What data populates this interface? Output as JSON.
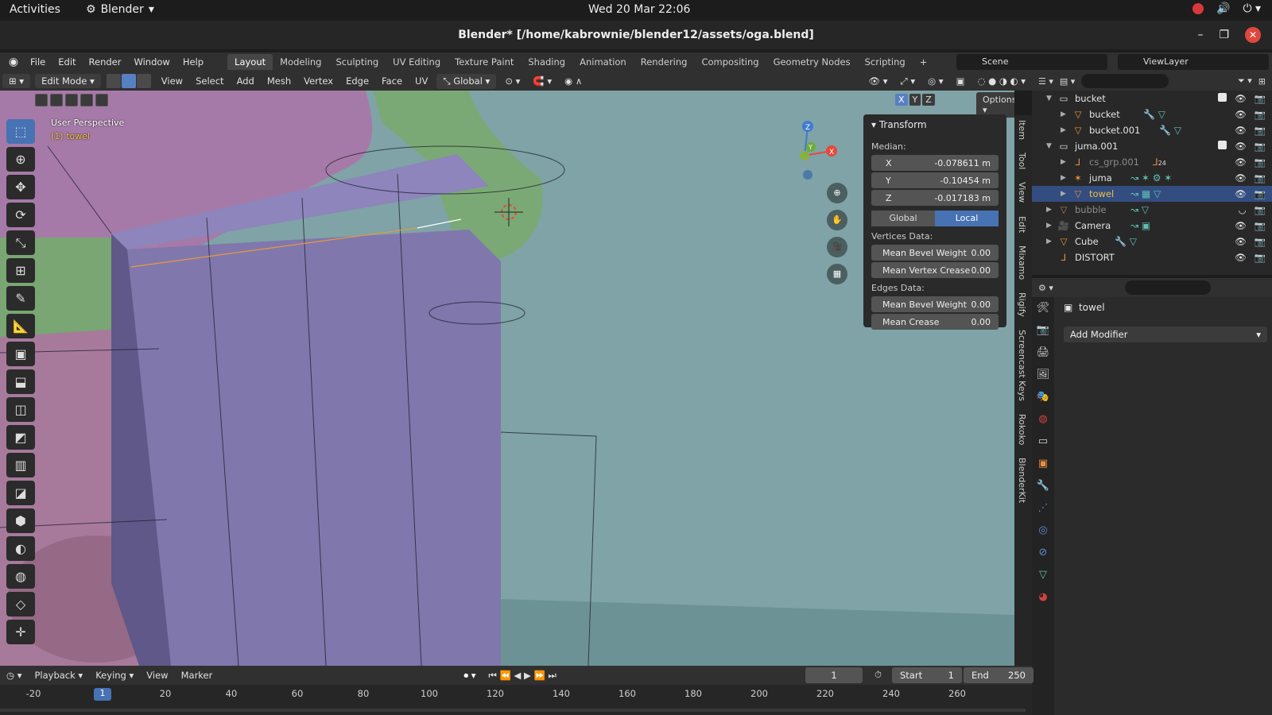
{
  "gnome": {
    "activities": "Activities",
    "app": "Blender",
    "clock": "Wed 20 Mar  22:06"
  },
  "window": {
    "title": "Blender* [/home/kabrownie/blender12/assets/oga.blend]"
  },
  "menu": {
    "items": [
      "File",
      "Edit",
      "Render",
      "Window",
      "Help"
    ]
  },
  "workspaces": {
    "tabs": [
      "Layout",
      "Modeling",
      "Sculpting",
      "UV Editing",
      "Texture Paint",
      "Shading",
      "Animation",
      "Rendering",
      "Compositing",
      "Geometry Nodes",
      "Scripting"
    ],
    "active": "Layout"
  },
  "scene": "Scene",
  "view_layer": "ViewLayer",
  "header": {
    "mode": "Edit Mode",
    "view": "View",
    "select": "Select",
    "add": "Add",
    "mesh": "Mesh",
    "vertex": "Vertex",
    "edge": "Edge",
    "face": "Face",
    "uv": "UV",
    "orientation": "Global"
  },
  "viewport": {
    "perspective": "User Perspective",
    "object": "(1) towel",
    "options": "Options",
    "axes": [
      "X",
      "Y",
      "Z"
    ]
  },
  "transform": {
    "title": "Transform",
    "median_label": "Median:",
    "x_label": "X",
    "x": "-0.078611 m",
    "y_label": "Y",
    "y": "-0.10454 m",
    "z_label": "Z",
    "z": "-0.017183 m",
    "global": "Global",
    "local": "Local",
    "vertices_label": "Vertices Data:",
    "mean_bevel_weight_label": "Mean Bevel Weight",
    "mean_bevel_weight": "0.00",
    "mean_vertex_crease_label": "Mean Vertex Crease",
    "mean_vertex_crease": "0.00",
    "edges_label": "Edges Data:",
    "edge_bevel_weight_label": "Mean Bevel Weight",
    "edge_bevel_weight": "0.00",
    "mean_crease_label": "Mean Crease",
    "mean_crease": "0.00"
  },
  "sidetabs": [
    "Item",
    "Tool",
    "View",
    "Edit",
    "Mixamo",
    "Rigify",
    "Screencast Keys",
    "Rokoko",
    "BlenderKit"
  ],
  "outliner": {
    "rows": [
      {
        "name": "bucket",
        "type": "collection"
      },
      {
        "name": "bucket",
        "type": "mesh"
      },
      {
        "name": "bucket.001",
        "type": "mesh"
      },
      {
        "name": "juma.001",
        "type": "collection"
      },
      {
        "name": "cs_grp.001",
        "type": "empty",
        "badge": "24"
      },
      {
        "name": "juma",
        "type": "armature"
      },
      {
        "name": "towel",
        "type": "mesh"
      },
      {
        "name": "bubble",
        "type": "mesh"
      },
      {
        "name": "Camera",
        "type": "camera"
      },
      {
        "name": "Cube",
        "type": "mesh"
      },
      {
        "name": "DISTORT",
        "type": "empty"
      }
    ]
  },
  "properties": {
    "object": "towel",
    "add_modifier": "Add Modifier"
  },
  "timeline": {
    "playback": "Playback",
    "keying": "Keying",
    "view": "View",
    "marker": "Marker",
    "current_frame": "1",
    "start_label": "Start",
    "start": "1",
    "end_label": "End",
    "end": "250",
    "ticks": [
      "-20",
      "1",
      "20",
      "40",
      "60",
      "80",
      "100",
      "120",
      "140",
      "160",
      "180",
      "200",
      "220",
      "240",
      "260"
    ]
  },
  "colors": {
    "accent": "#4772b3",
    "viewport_bg": "#7fa3a6",
    "mesh_face": "#7c74a8",
    "skin_green": "#79a873",
    "skin_purple": "#a57aa7"
  }
}
